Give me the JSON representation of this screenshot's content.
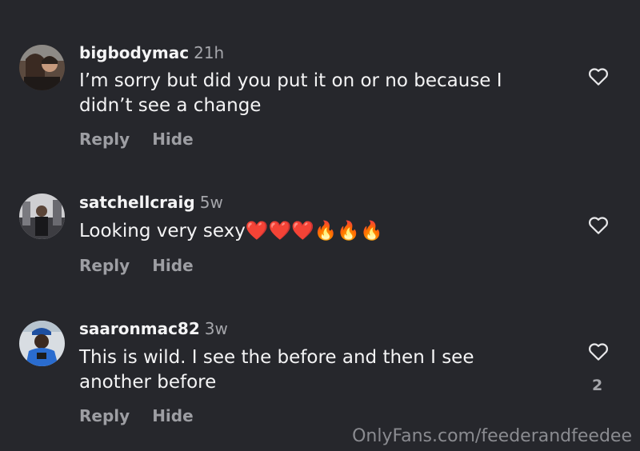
{
  "comments": [
    {
      "username": "bigbodymac",
      "time": "21h",
      "text": "I’m sorry but did you put it on or no because I didn’t see a change",
      "reply_label": "Reply",
      "hide_label": "Hide",
      "like_count": ""
    },
    {
      "username": "satchellcraig",
      "time": "5w",
      "text": "Looking very sexy❤️❤️❤️🔥🔥🔥",
      "reply_label": "Reply",
      "hide_label": "Hide",
      "like_count": ""
    },
    {
      "username": "saaronmac82",
      "time": "3w",
      "text": "This is wild. I see the before and then I see another before",
      "reply_label": "Reply",
      "hide_label": "Hide",
      "like_count": "2"
    }
  ],
  "watermark": "OnlyFans.com/feederandfeedee",
  "colors": {
    "background": "#26272c",
    "text": "#f4f4f5",
    "muted": "#9d9ea3"
  }
}
